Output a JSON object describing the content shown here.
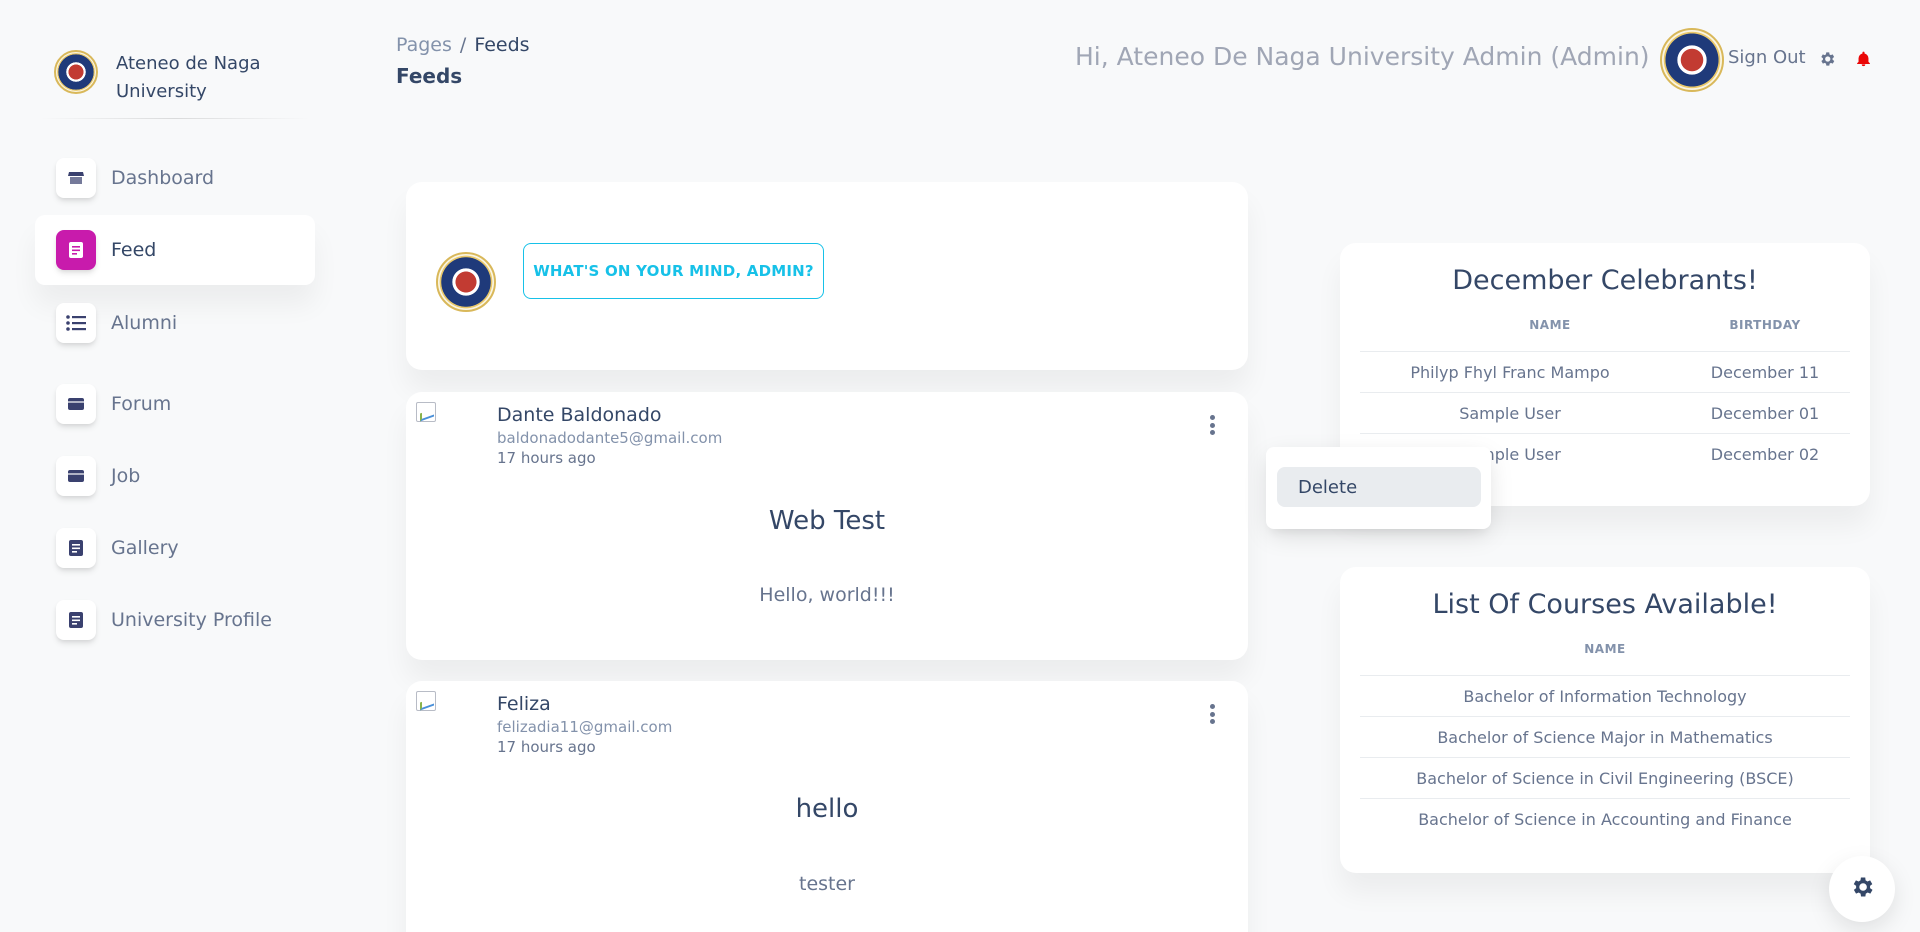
{
  "sidebar": {
    "brand": "Ateneo de Naga University",
    "items": [
      {
        "label": "Dashboard",
        "icon": "shop-icon"
      },
      {
        "label": "Feed",
        "icon": "document-icon",
        "active": true
      },
      {
        "label": "Alumni",
        "icon": "list-icon"
      },
      {
        "label": "Forum",
        "icon": "credit-card-icon"
      },
      {
        "label": "Job",
        "icon": "credit-card-icon"
      },
      {
        "label": "Gallery",
        "icon": "document-icon"
      },
      {
        "label": "University Profile",
        "icon": "document-icon"
      }
    ]
  },
  "header": {
    "breadcrumb_root": "Pages",
    "breadcrumb_sep": "/",
    "breadcrumb_current": "Feeds",
    "page_title": "Feeds",
    "greeting": "Hi, Ateneo De Naga University Admin (Admin)",
    "signout_label": "Sign Out"
  },
  "composer": {
    "button_label": "WHAT'S ON YOUR MIND, ADMIN?"
  },
  "posts": [
    {
      "author": "Dante Baldonado",
      "email": "baldonadodante5@gmail.com",
      "time": "17 hours ago",
      "title": "Web Test",
      "body": "Hello, world!!!"
    },
    {
      "author": "Feliza",
      "email": "felizadia11@gmail.com",
      "time": "17 hours ago",
      "title": "hello",
      "body": "tester"
    }
  ],
  "dropdown": {
    "delete_label": "Delete"
  },
  "celebrants": {
    "title": "December Celebrants!",
    "col_name": "NAME",
    "col_birthday": "BIRTHDAY",
    "rows": [
      {
        "name": "Philyp Fhyl Franc Mampo",
        "birthday": "December 11"
      },
      {
        "name": "Sample User",
        "birthday": "December 01"
      },
      {
        "name": "Sample User",
        "birthday": "December 02"
      }
    ]
  },
  "courses": {
    "title": "List Of Courses Available!",
    "col_name": "NAME",
    "rows": [
      "Bachelor of Information Technology",
      "Bachelor of Science Major in Mathematics",
      "Bachelor of Science in Civil Engineering (BSCE)",
      "Bachelor of Science in Accounting and Finance"
    ]
  },
  "colors": {
    "accent_pink": "#c81bac",
    "accent_cyan": "#17c1e8",
    "notification_red": "#ea0606",
    "text_dark": "#344767",
    "text_muted": "#67748e"
  }
}
